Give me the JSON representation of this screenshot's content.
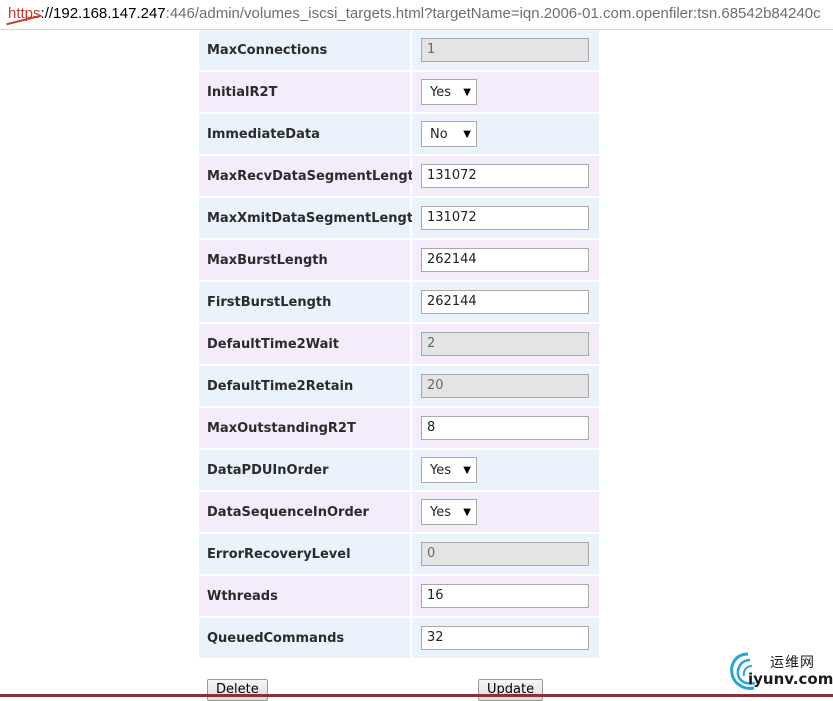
{
  "url": {
    "scheme": "https",
    "host": "://192.168.147.247",
    "rest": ":446/admin/volumes_iscsi_targets.html?targetName=iqn.2006-01.com.openfiler:tsn.68542b84240c"
  },
  "rows": [
    {
      "label": "MaxConnections",
      "value": "1"
    },
    {
      "label": "InitialR2T",
      "value": "Yes"
    },
    {
      "label": "ImmediateData",
      "value": "No"
    },
    {
      "label": "MaxRecvDataSegmentLength",
      "value": "131072"
    },
    {
      "label": "MaxXmitDataSegmentLength",
      "value": "131072"
    },
    {
      "label": "MaxBurstLength",
      "value": "262144"
    },
    {
      "label": "FirstBurstLength",
      "value": "262144"
    },
    {
      "label": "DefaultTime2Wait",
      "value": "2"
    },
    {
      "label": "DefaultTime2Retain",
      "value": "20"
    },
    {
      "label": "MaxOutstandingR2T",
      "value": "8"
    },
    {
      "label": "DataPDUInOrder",
      "value": "Yes"
    },
    {
      "label": "DataSequenceInOrder",
      "value": "Yes"
    },
    {
      "label": "ErrorRecoveryLevel",
      "value": "0"
    },
    {
      "label": "Wthreads",
      "value": "16"
    },
    {
      "label": "QueuedCommands",
      "value": "32"
    }
  ],
  "buttons": {
    "delete": "Delete",
    "update": "Update"
  },
  "watermark": {
    "cn": "运维网",
    "en": "iyunv.com"
  },
  "colors": {
    "row_blue": "#eaf3fb",
    "row_pink": "#f4ecfb",
    "readonly_bg": "#e4e4e4"
  }
}
